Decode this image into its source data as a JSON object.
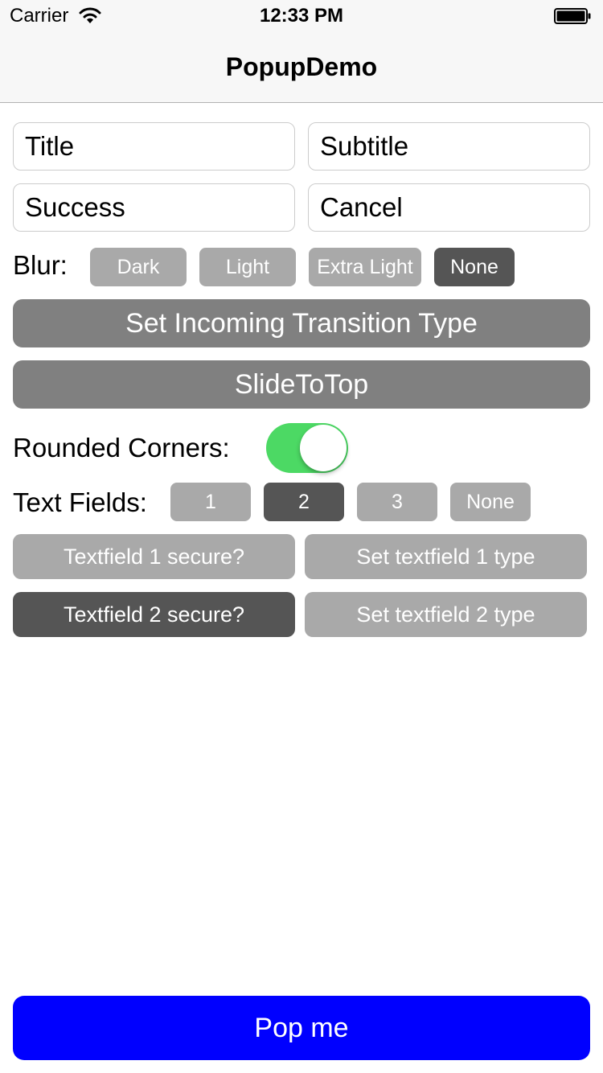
{
  "status_bar": {
    "carrier": "Carrier",
    "time": "12:33 PM",
    "wifi_icon": "wifi-icon",
    "battery_icon": "battery-icon"
  },
  "nav": {
    "title": "PopupDemo"
  },
  "fields": {
    "title": "Title",
    "subtitle": "Subtitle",
    "success": "Success",
    "cancel": "Cancel"
  },
  "blur": {
    "label": "Blur:",
    "options": [
      "Dark",
      "Light",
      "Extra Light",
      "None"
    ],
    "selected": "None"
  },
  "transition": {
    "set_label": "Set Incoming Transition Type",
    "value": "SlideToTop"
  },
  "rounded_corners": {
    "label": "Rounded Corners:",
    "on": true
  },
  "text_fields": {
    "label": "Text Fields:",
    "options": [
      "1",
      "2",
      "3",
      "None"
    ],
    "selected": "2"
  },
  "textfield_options": {
    "secure_1": "Textfield 1 secure?",
    "type_1": "Set textfield 1 type",
    "secure_2": "Textfield 2 secure?",
    "type_2": "Set textfield 2 type"
  },
  "pop_button": {
    "label": "Pop me"
  },
  "colors": {
    "toggle_on": "#4cd964",
    "pop_button": "#0000ff",
    "button_light": "#a9a9a9",
    "button_dark": "#555555",
    "button_wide": "#808080"
  }
}
